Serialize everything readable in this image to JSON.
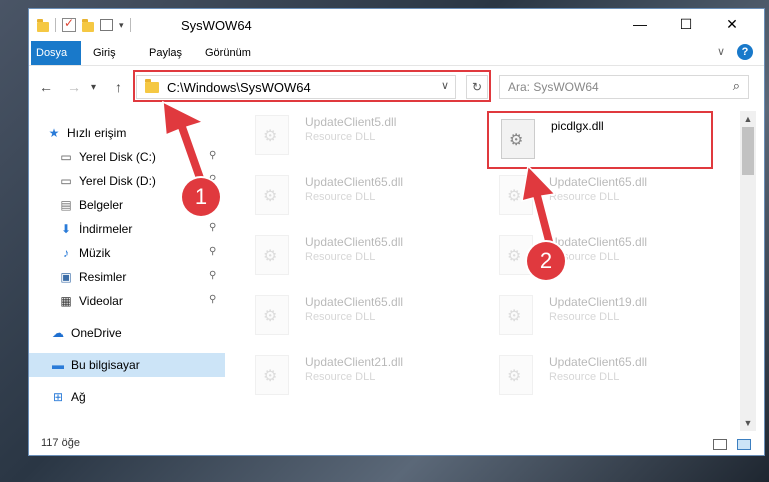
{
  "window": {
    "title": "SysWOW64",
    "controls": {
      "minimize": "—",
      "maximize": "☐",
      "close": "✕"
    }
  },
  "ribbon": {
    "tabs": [
      "Dosya",
      "Giriş",
      "Paylaş",
      "Görünüm"
    ],
    "collapse_icon": "chevron-down-icon",
    "help": "?"
  },
  "navigation": {
    "back": "←",
    "forward": "→",
    "recent": "▾",
    "up": "↑",
    "address": "C:\\Windows\\SysWOW64",
    "search_placeholder": "Ara: SysWOW64"
  },
  "sidebar": {
    "items": [
      {
        "label": "Hızlı erişim",
        "icon": "star-icon",
        "glyph": "★",
        "color": "#2a7bd8",
        "pinned": false
      },
      {
        "label": "Yerel Disk (C:)",
        "icon": "drive-icon",
        "glyph": "▭",
        "color": "#555555",
        "pinned": true
      },
      {
        "label": "Yerel Disk (D:)",
        "icon": "drive-icon",
        "glyph": "▭",
        "color": "#555555",
        "pinned": true
      },
      {
        "label": "Belgeler",
        "icon": "document-icon",
        "glyph": "▤",
        "color": "#6f6f6f",
        "pinned": true
      },
      {
        "label": "İndirmeler",
        "icon": "download-icon",
        "glyph": "⬇",
        "color": "#2a7bd8",
        "pinned": true
      },
      {
        "label": "Müzik",
        "icon": "music-icon",
        "glyph": "♪",
        "color": "#2a7bd8",
        "pinned": true
      },
      {
        "label": "Resimler",
        "icon": "picture-icon",
        "glyph": "▣",
        "color": "#3c6ea8",
        "pinned": true
      },
      {
        "label": "Videolar",
        "icon": "video-icon",
        "glyph": "▦",
        "color": "#333333",
        "pinned": true
      },
      {
        "label": "OneDrive",
        "icon": "cloud-icon",
        "glyph": "☁",
        "color": "#1e6fd0",
        "pinned": false
      },
      {
        "label": "Bu bilgisayar",
        "icon": "computer-icon",
        "glyph": "▬",
        "color": "#2a7bd8",
        "pinned": false,
        "selected": true
      },
      {
        "label": "Ağ",
        "icon": "network-icon",
        "glyph": "⊞",
        "color": "#2a7bd8",
        "pinned": false
      }
    ],
    "pin_glyph": "📌"
  },
  "files": [
    {
      "name": "UpdateClient5.dll",
      "desc": "Resource DLL"
    },
    {
      "name": "picdlgx.dll",
      "desc": "",
      "highlighted": true
    },
    {
      "name": "UpdateClient65.dll",
      "desc": "Resource DLL"
    },
    {
      "name": "UpdateClient65.dll",
      "desc": "Resource DLL"
    },
    {
      "name": "UpdateClient65.dll",
      "desc": "Resource DLL"
    },
    {
      "name": "UpdateClient65.dll",
      "desc": "Resource DLL"
    },
    {
      "name": "UpdateClient65.dll",
      "desc": "Resource DLL"
    },
    {
      "name": "UpdateClient19.dll",
      "desc": "Resource DLL"
    },
    {
      "name": "UpdateClient21.dll",
      "desc": "Resource DLL"
    },
    {
      "name": "UpdateClient65.dll",
      "desc": "Resource DLL"
    }
  ],
  "status": {
    "count": "117 öğe"
  },
  "annotations": {
    "step1": "1",
    "step2": "2",
    "color": "#e0393e"
  }
}
